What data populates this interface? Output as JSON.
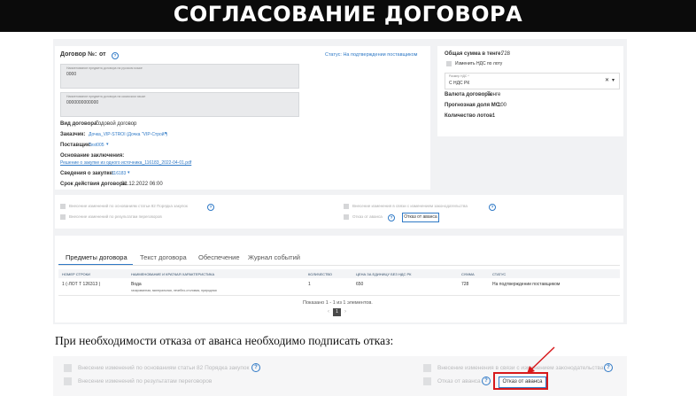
{
  "slide": {
    "title": "СОГЛАСОВАНИЕ ДОГОВОРА",
    "caption": "При необходимости отказа от аванса необходимо подписать отказ:"
  },
  "contract": {
    "header": "Договор №:",
    "header_from": "от",
    "status": "Статус: На подтверждении поставщиком",
    "name_ru_label": "Наименование предмета договора на русском языке",
    "name_ru_value": "0000",
    "name_kz_label": "Наименование предмета договора на казахском языке",
    "name_kz_value": "0000000000000",
    "type_label": "Вид договора:",
    "type_value": "Годовой договор",
    "customer_label": "Заказчик:",
    "customer_value": "Дочка_VIP-STROI (Дочка \"VIP-Строй\")",
    "supplier_label": "Поставщик:",
    "supplier_value": "Test005",
    "basis_label": "Основание заключения:",
    "basis_value": "Решение о закупке из одного источника_116183_2022-04-01.pdf",
    "purchase_label": "Сведения о закупке:",
    "purchase_value": "116183",
    "term_label": "Срок действия договора:",
    "term_value": "31.12.2022 06:00"
  },
  "summary": {
    "total_label": "Общая сумма в тенге:",
    "total_value": "728",
    "change_vat": "Изменить НДС по лоту",
    "vat_label": "Размер НДС *",
    "vat_value": "С НДС РК",
    "currency_label": "Валюта договора:",
    "currency_value": "Тенге",
    "ms_label": "Прогнозная доля МС:",
    "ms_value": "100",
    "lots_label": "Количество лотов:",
    "lots_value": "1"
  },
  "options": {
    "opt1": "Внесение изменений по основаниям статьи 82 Порядка закупок",
    "opt2": "Внесение изменений по результатам переговоров",
    "opt3": "Внесение изменения в связи с изменением законодательства",
    "opt4": "Отказ от аванса",
    "advance_button": "Отказ от аванса"
  },
  "tabs": [
    "Предметы договора",
    "Текст договора",
    "Обеспечение",
    "Журнал событий"
  ],
  "table": {
    "headers": [
      "НОМЕР СТРОКИ",
      "НАИМЕНОВАНИЕ И КРАТКАЯ ХАРАКТЕРИСТИКА",
      "КОЛИЧЕСТВО",
      "ЦЕНА ЗА ЕДИНИЦУ БЕЗ НДС РК",
      "СУММА",
      "СТАТУС"
    ],
    "row": {
      "number": "1 (-ЛОТ Т 126313 )",
      "name": "Вода",
      "desc": "газированная, минеральная, лечебно-столовая, природная",
      "qty": "1",
      "price": "650",
      "sum": "728",
      "status": "На подтверждении поставщиком"
    },
    "pagination": "Показано 1 - 1 из 1 элементов.",
    "prev": "‹",
    "page": "1",
    "next": "›"
  },
  "colors": {
    "accent": "#2f79c6",
    "highlight": "#d7191c",
    "title_bar": "#0b0b0b"
  }
}
